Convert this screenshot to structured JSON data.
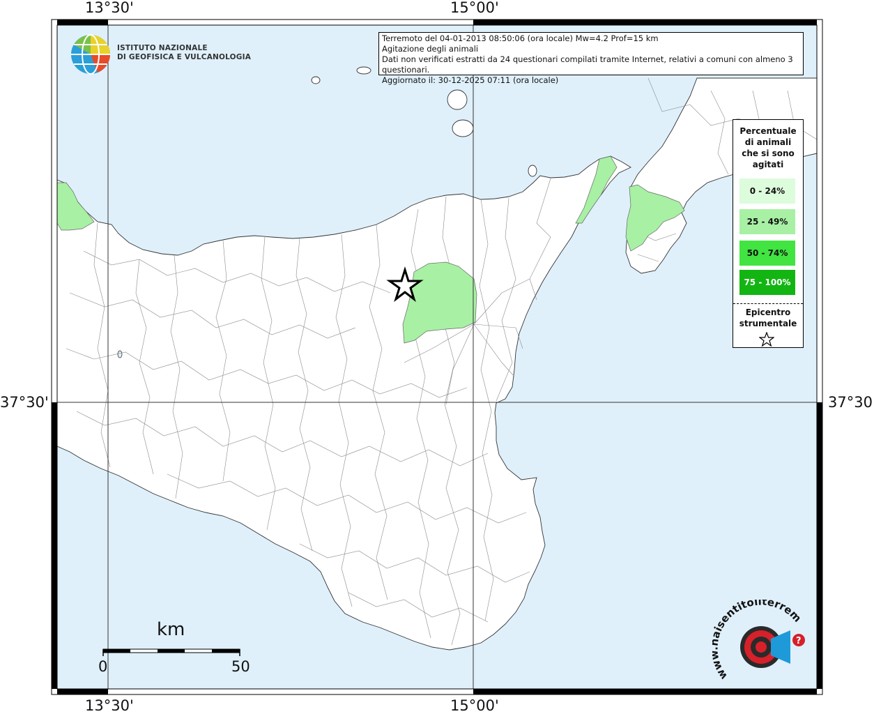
{
  "map": {
    "lon_labels_top": [
      "13°30'",
      "15°00'"
    ],
    "lon_labels_bottom": [
      "13°30'",
      "15°00'"
    ],
    "lat_label_left": "37°30'",
    "lat_label_right": "37°30'",
    "colors": {
      "sea": "#dff0fb",
      "land": "#ffffff",
      "frame": "#000000",
      "class_0_24": "#ddfcdc",
      "class_25_49": "#a8f0a4",
      "class_50_74": "#41e441",
      "class_75_100": "#13b513"
    }
  },
  "institute": {
    "line1": "ISTITUTO NAZIONALE",
    "line2": "DI GEOFISICA E VULCANOLOGIA"
  },
  "info": {
    "line1": "Terremoto del 04-01-2013 08:50:06 (ora locale) Mw=4.2 Prof=15 km",
    "line2": "Agitazione degli animali",
    "line3": "Dati non verificati estratti da 24 questionari compilati tramite Internet, relativi a comuni con almeno 3 questionari.",
    "line4": "Aggiornato il: 30-12-2025 07:11 (ora locale)"
  },
  "legend": {
    "title_lines": [
      "Percentuale",
      "di animali",
      "che si sono",
      "agitati"
    ],
    "classes": [
      {
        "label": "0 - 24%",
        "color": "#ddfcdc"
      },
      {
        "label": "25 - 49%",
        "color": "#a8f0a4"
      },
      {
        "label": "50 - 74%",
        "color": "#41e441"
      },
      {
        "label": "75 - 100%",
        "color": "#13b513"
      }
    ],
    "epicenter_lines": [
      "Epicentro",
      "strumentale"
    ],
    "epicenter_icon": "star-icon"
  },
  "scale": {
    "unit": "km",
    "min_label": "0",
    "max_label": "50"
  },
  "haisentito": {
    "url_text": "www.haisentitoilterremoto.it",
    "question_mark": "?"
  }
}
